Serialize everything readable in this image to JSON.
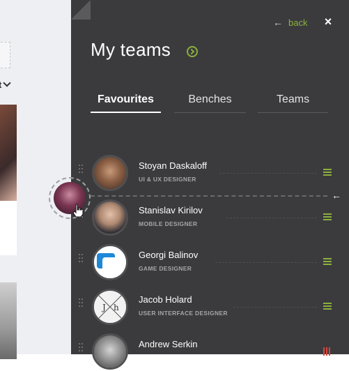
{
  "header": {
    "back_label": "back",
    "close_label": "×",
    "title": "My teams"
  },
  "tabs": [
    {
      "label": "Favourites",
      "active": true
    },
    {
      "label": "Benches",
      "active": false
    },
    {
      "label": "Teams",
      "active": false
    }
  ],
  "members": [
    {
      "name": "Stoyan Daskaloff",
      "role": "UI & UX DESIGNER"
    },
    {
      "name": "Stanislav Kirilov",
      "role": "MOBILE DESIGNER"
    },
    {
      "name": "Georgi Balinov",
      "role": "GAME DESIGNER"
    },
    {
      "name": "Jacob Holard",
      "role": "USER INTERFACE DESIGNER"
    },
    {
      "name": "Andrew Serkin",
      "role": ""
    }
  ],
  "colors": {
    "accent": "#8cb03c",
    "panel_bg": "#3b3b3d",
    "alert": "#d6453d"
  },
  "icons": [
    "back-arrow-icon",
    "close-icon",
    "chevron-circle-icon",
    "drag-handle-icon",
    "menu-icon",
    "hand-cursor-icon"
  ]
}
